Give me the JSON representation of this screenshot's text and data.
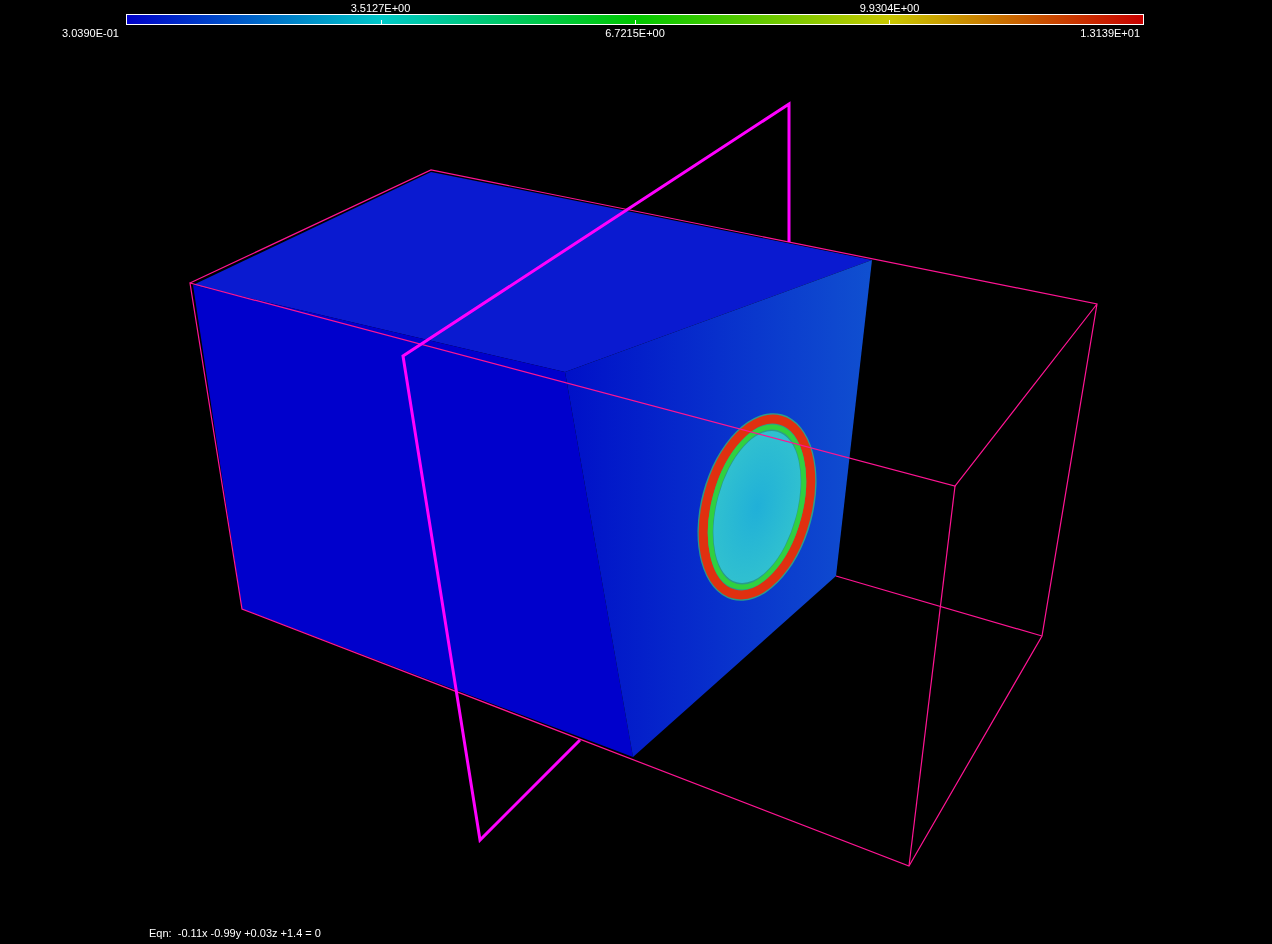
{
  "colorbar": {
    "labels_top": [
      "3.5127E+00",
      "9.9304E+00"
    ],
    "labels_bottom": [
      "3.0390E-01",
      "6.7215E+00",
      "1.3139E+01"
    ]
  },
  "equation": "Eqn:  -0.11x -0.99y +0.03z +1.4 = 0"
}
